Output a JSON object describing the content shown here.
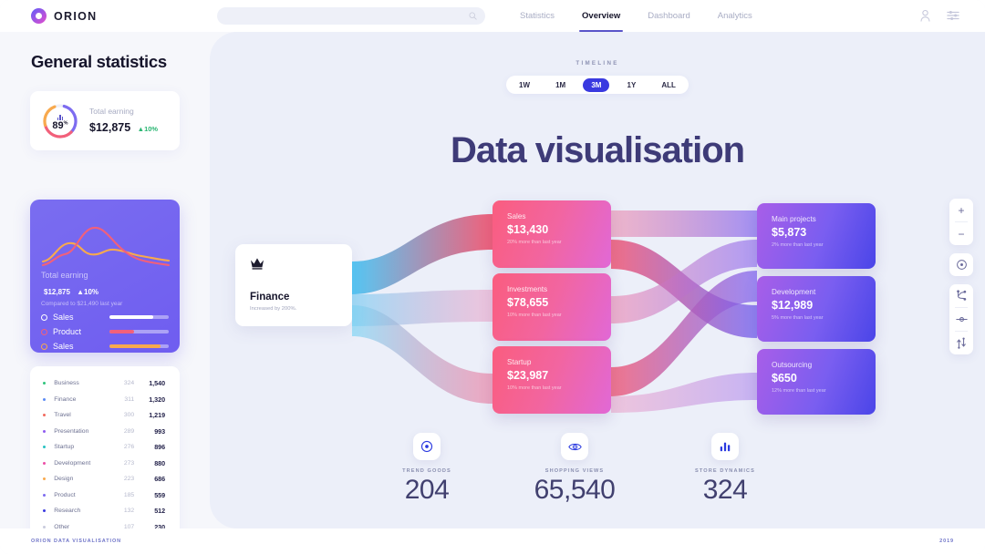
{
  "brand": {
    "name": "ORION"
  },
  "search": {
    "placeholder": "",
    "value": "",
    "icon": "search-icon"
  },
  "nav": {
    "items": [
      {
        "label": "Statistics",
        "active": false
      },
      {
        "label": "Overview",
        "active": true
      },
      {
        "label": "Dashboard",
        "active": false
      },
      {
        "label": "Analytics",
        "active": false
      }
    ],
    "account_icon": "user-icon",
    "settings_icon": "sliders-icon"
  },
  "sidebar": {
    "title": "General statistics",
    "earning_card": {
      "percent": "89",
      "percent_suffix": "%",
      "label": "Total earning",
      "amount": "$12,875",
      "delta": "▲10%",
      "icon": "bar-chart-icon",
      "ring_colors": [
        "#7d6cf0",
        "#f2607a",
        "#f8a94d"
      ]
    },
    "highlight_card": {
      "label": "Total earning",
      "amount": "$12,875",
      "delta": "▲10%",
      "compared": "Compared to $21,490 last year",
      "legend": [
        {
          "name": "Sales",
          "color": "#ffffff",
          "pct": 74
        },
        {
          "name": "Product",
          "color": "#f2607a",
          "pct": 42
        },
        {
          "name": "Sales",
          "color": "#f8a94d",
          "pct": 86
        }
      ]
    },
    "list": [
      {
        "name": "Business",
        "mid": "324",
        "val": "1,540",
        "color": "#2fc47c"
      },
      {
        "name": "Finance",
        "mid": "311",
        "val": "1,320",
        "color": "#5b8bf5"
      },
      {
        "name": "Travel",
        "mid": "300",
        "val": "1,219",
        "color": "#f26a5e"
      },
      {
        "name": "Presentation",
        "mid": "289",
        "val": "993",
        "color": "#8f5bf0"
      },
      {
        "name": "Startup",
        "mid": "276",
        "val": "896",
        "color": "#27c2c2"
      },
      {
        "name": "Development",
        "mid": "273",
        "val": "880",
        "color": "#ec4fa7"
      },
      {
        "name": "Design",
        "mid": "223",
        "val": "686",
        "color": "#f8a94d"
      },
      {
        "name": "Product",
        "mid": "185",
        "val": "559",
        "color": "#7d6cf0"
      },
      {
        "name": "Research",
        "mid": "132",
        "val": "512",
        "color": "#3a3ae0"
      },
      {
        "name": "Other",
        "mid": "107",
        "val": "230",
        "color": "#c9cbdd"
      }
    ]
  },
  "main": {
    "timeline_label": "TIMELINE",
    "timeline": [
      {
        "label": "1W",
        "active": false
      },
      {
        "label": "1M",
        "active": false
      },
      {
        "label": "3M",
        "active": true
      },
      {
        "label": "1Y",
        "active": false
      },
      {
        "label": "ALL",
        "active": false
      }
    ],
    "title": "Data visualisation",
    "source": {
      "icon": "crown-icon",
      "name": "Finance",
      "sub": "Increased by 200%."
    },
    "middle_nodes": [
      {
        "label": "Sales",
        "value": "$13,430",
        "sub": "20% more than last year"
      },
      {
        "label": "Investments",
        "value": "$78,655",
        "sub": "10% more than last year"
      },
      {
        "label": "Startup",
        "value": "$23,987",
        "sub": "10% more than last year"
      }
    ],
    "right_nodes": [
      {
        "label": "Main projects",
        "value": "$5,873",
        "sub": "2% more than last year"
      },
      {
        "label": "Development",
        "value": "$12,989",
        "sub": "5% more than last year"
      },
      {
        "label": "Outsourcing",
        "value": "$650",
        "sub": "12% more than last year"
      }
    ],
    "stats": [
      {
        "label": "TREND GOODS",
        "value": "204",
        "icon": "target-icon"
      },
      {
        "label": "SHOPPING VIEWS",
        "value": "65,540",
        "icon": "eye-icon"
      },
      {
        "label": "STORE DYNAMICS",
        "value": "324",
        "icon": "bar-chart-icon"
      }
    ]
  },
  "toolbar": {
    "zoom_in": "+",
    "zoom_out": "−",
    "center": "target-icon",
    "branch": "branch-icon",
    "node": "node-icon",
    "compare": "compare-icon"
  },
  "footer": {
    "left": "ORION DATA VISUALISATION",
    "right": "2019"
  },
  "colors": {
    "accent": "#3a3ae0",
    "panel_bg": "#eceff9",
    "pink": "#f2607a",
    "violet": "#7a5ef0"
  }
}
